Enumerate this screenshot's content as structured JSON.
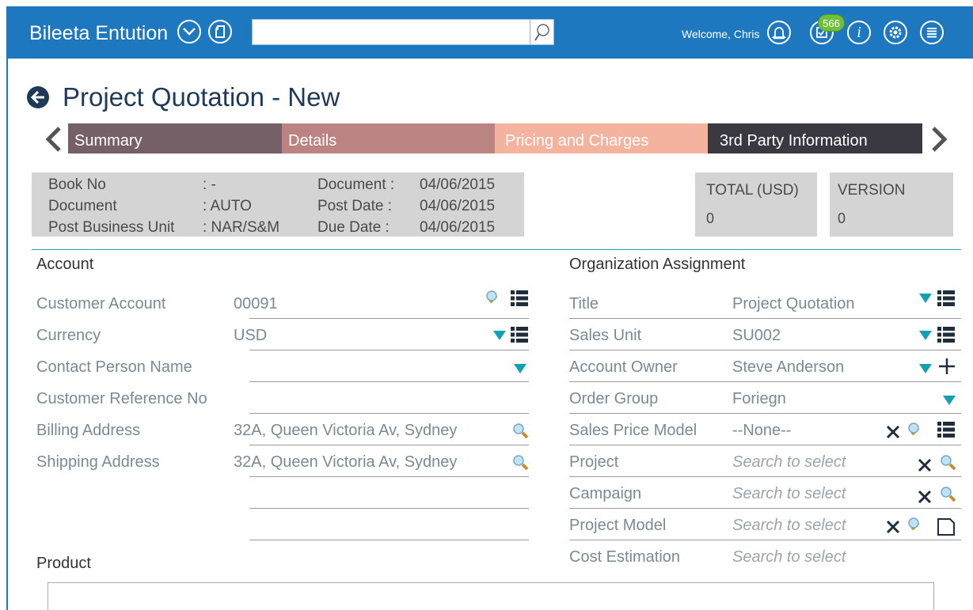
{
  "topbar": {
    "brand": "Bileeta Entution",
    "search_value": "",
    "welcome": "Welcome, Chris",
    "notification_count": "566"
  },
  "page": {
    "title": "Project Quotation - New"
  },
  "tabs": [
    {
      "label": "Summary",
      "color": "#756068"
    },
    {
      "label": "Details",
      "color": "#bb8482"
    },
    {
      "label": "Pricing and Charges",
      "color": "#f3b39e"
    },
    {
      "label": "3rd Party Information",
      "color": "#3a3840"
    }
  ],
  "header_info": {
    "book_no_label": "Book No",
    "book_no_sep": ": -",
    "document_label": "Document",
    "document_sep": ": AUTO",
    "pbu_label": "Post Business Unit",
    "pbu_sep": ": NAR/S&M",
    "doc_date_label": "Document :",
    "doc_date": "04/06/2015",
    "post_date_label": "Post Date  :",
    "post_date": "04/06/2015",
    "due_date_label": "Due Date  :",
    "due_date": "04/06/2015"
  },
  "totals": {
    "total_label": "TOTAL (USD)",
    "total_value": "0",
    "version_label": "VERSION",
    "version_value": "0"
  },
  "account": {
    "heading": "Account",
    "customer_account_label": "Customer Account",
    "customer_account_value": "00091",
    "currency_label": "Currency",
    "currency_value": "USD",
    "contact_person_label": "Contact Person Name",
    "contact_person_value": "",
    "customer_ref_label": "Customer Reference No",
    "customer_ref_value": "",
    "billing_label": "Billing Address",
    "billing_value": "32A, Queen Victoria Av, Sydney",
    "shipping_label": "Shipping Address",
    "shipping_value": "32A, Queen Victoria Av, Sydney"
  },
  "org": {
    "heading": "Organization Assignment",
    "title_label": "Title",
    "title_value": "Project Quotation",
    "sales_unit_label": "Sales Unit",
    "sales_unit_value": "SU002",
    "account_owner_label": "Account Owner",
    "account_owner_value": "Steve Anderson",
    "order_group_label": "Order Group",
    "order_group_value": "Foriegn",
    "price_model_label": "Sales Price Model",
    "price_model_value": "--None--",
    "project_label": "Project",
    "project_value": "Search to select",
    "campaign_label": "Campaign",
    "campaign_value": "Search to select",
    "project_model_label": "Project Model",
    "project_model_value": "Search to select",
    "cost_est_label": "Cost Estimation",
    "cost_est_value": "Search to select"
  },
  "product": {
    "heading": "Product"
  }
}
